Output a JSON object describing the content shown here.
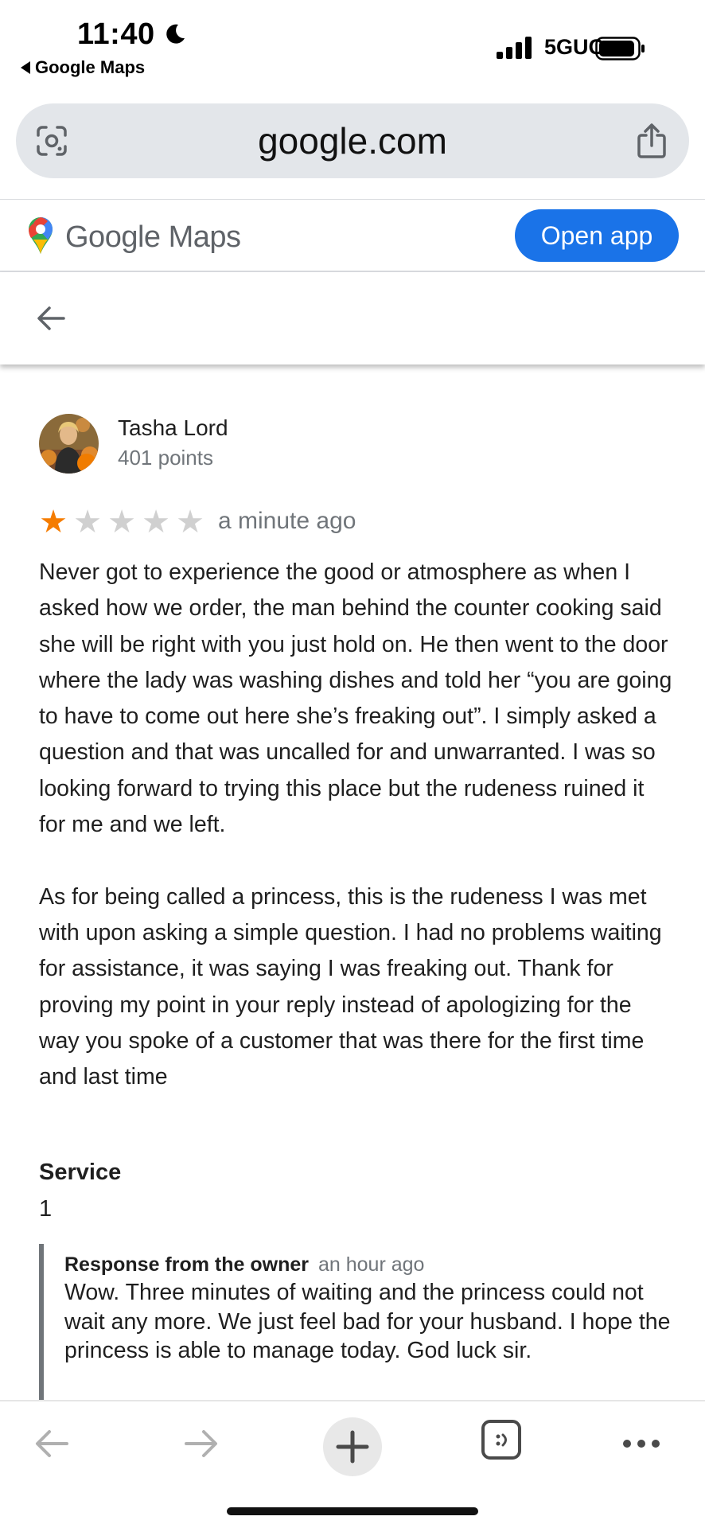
{
  "status_bar": {
    "time": "11:40",
    "back_app": "Google Maps",
    "network": "5GUC",
    "icons": [
      "moon-icon",
      "signal-icon",
      "battery-icon"
    ]
  },
  "browser": {
    "url": "google.com",
    "icons": [
      "lens-icon",
      "share-icon"
    ]
  },
  "maps_header": {
    "logo_text": "Google Maps",
    "open_app_label": "Open app",
    "brand_color": "#1a73e8"
  },
  "review": {
    "reviewer_name": "Tasha Lord",
    "reviewer_points": "401 points",
    "rating": 1,
    "max_rating": 5,
    "star_color": "#f57c00",
    "time": "a minute ago",
    "paragraphs": [
      "Never got to experience the good or atmosphere as when I asked how we order, the man behind the counter cooking said she will be right with you just hold on. He then went to the door where the lady was washing dishes and told her “you are going to have to come out here she’s freaking out”. I simply asked a question and that was uncalled for and unwarranted. I was so looking forward to trying this place but the rudeness ruined it for me and we left.",
      "As for being called a princess, this is the rudeness I was met with upon asking a simple question. I had no problems waiting for assistance, it was saying I was freaking out. Thank for proving my point in your reply instead of apologizing for the way you spoke of a customer that was there for the first time and last time"
    ],
    "service_label": "Service",
    "service_value": "1"
  },
  "owner_response": {
    "title": "Response from the owner",
    "time": "an hour ago",
    "text": "Wow. Three minutes of waiting and the princess could not wait any more.  We just feel bad for your husband.  I hope the princess is able to manage today.  God luck sir."
  },
  "toolbar": {
    "icons": [
      "back-arrow-icon",
      "forward-arrow-icon",
      "plus-icon",
      "tabs-icon",
      "more-icon"
    ]
  }
}
